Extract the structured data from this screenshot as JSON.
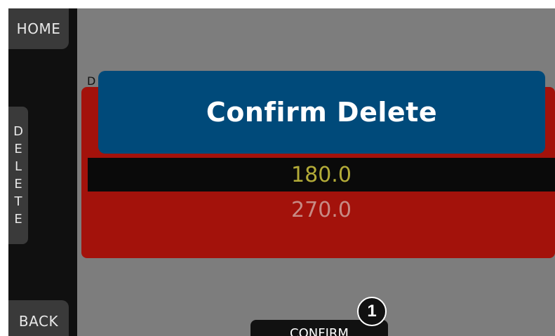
{
  "sidebar": {
    "home_label": "HOME",
    "delete_letters": [
      "D",
      "E",
      "L",
      "E",
      "T",
      "E"
    ],
    "back_label": "BACK"
  },
  "list": {
    "header_letter": "D",
    "rows": [
      {
        "value": "180.0",
        "selected": true
      },
      {
        "value": "270.0",
        "selected": false
      }
    ]
  },
  "dialog": {
    "title": "Confirm Delete"
  },
  "footer": {
    "confirm_label": "CONFIRM"
  },
  "annotation": {
    "callout_number": "1"
  },
  "colors": {
    "dialog_bg": "#004a7a",
    "list_bg": "#a3120b",
    "selected_text": "#b3ab38",
    "screen_bg": "#7d7d7d"
  }
}
